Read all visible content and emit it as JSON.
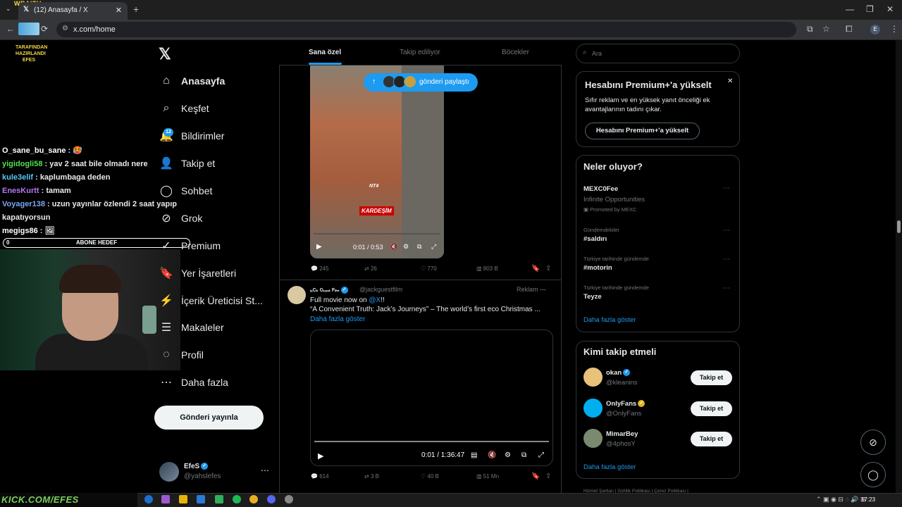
{
  "browser": {
    "overlay_tag": "WRAITH",
    "tab_title": "(12) Anasayfa / X",
    "tab_close": "✕",
    "new_tab": "+",
    "url": "x.com/home",
    "profile_initial": "E",
    "window_controls": [
      "—",
      "❐",
      "✕"
    ]
  },
  "stream_overlay": {
    "logo_text": "TARAFINDAN HAZIRLANDI EFES",
    "chat": [
      {
        "user": "O_sane_bu_sane",
        "user_color": "#ffffff",
        "msg": "🥵"
      },
      {
        "user": "yigidogli58",
        "user_color": "#4ee04e",
        "msg": "yav 2 saat bile olmadı nere"
      },
      {
        "user": "kule3elif",
        "user_color": "#58c8f0",
        "msg": "kaplumbaga deden"
      },
      {
        "user": "EnesKurtt",
        "user_color": "#b478f0",
        "msg": "tamam"
      },
      {
        "user": "Voyager138",
        "user_color": "#7aa6f0",
        "msg": "uzun yayınlar özlendi 2 saat yapıp kapatıyorsun"
      },
      {
        "user": "megigs86",
        "user_color": "#ffffff",
        "msg": "🖼"
      }
    ],
    "goal_count": "0",
    "goal_label": "ABONE HEDEF"
  },
  "sidebar": {
    "logo": "𝕏",
    "items": [
      {
        "label": "Anasayfa",
        "icon": "home-icon",
        "glyph": "⌂",
        "bold": true
      },
      {
        "label": "Keşfet",
        "icon": "search-icon",
        "glyph": "⌕"
      },
      {
        "label": "Bildirimler",
        "icon": "bell-icon",
        "glyph": "🔔"
      },
      {
        "label": "Takip et",
        "icon": "follow-icon",
        "glyph": "👤"
      },
      {
        "label": "Sohbet",
        "icon": "chat-icon",
        "glyph": "◯"
      },
      {
        "label": "Grok",
        "icon": "grok-icon",
        "glyph": "⊘"
      },
      {
        "label": "Premium",
        "icon": "premium-icon",
        "glyph": "✓"
      },
      {
        "label": "Yer İşaretleri",
        "icon": "bookmark-icon",
        "glyph": "🔖"
      },
      {
        "label": "İçerik Üreticisi St...",
        "icon": "creator-icon",
        "glyph": "⚡"
      },
      {
        "label": "Makaleler",
        "icon": "article-icon",
        "glyph": "☰"
      },
      {
        "label": "Profil",
        "icon": "profile-icon",
        "glyph": "◌"
      },
      {
        "label": "Daha fazla",
        "icon": "more-icon",
        "glyph": "⋯"
      }
    ],
    "notif_count": "12",
    "post_button": "Gönderi yayınla",
    "account": {
      "name": "EfeS",
      "handle": "@yahslefes",
      "more": "⋯"
    }
  },
  "feed": {
    "tabs": [
      "Sana özel",
      "Takip ediliyor",
      "Böcekler"
    ],
    "share_pill": "gönderi paylaştı",
    "tweet1": {
      "video_text_logo": "NT4",
      "video_caption": "KARDEŞİM",
      "time": "0:01 / 0:53",
      "replies": "245",
      "retweets": "26",
      "likes": "770",
      "views": "803 B"
    },
    "tweet2": {
      "name": "ᵢₐCₖ Gᵤₑₛₜ Fᵢₗₘ",
      "handle": "@jackguestfilm",
      "ad_label": "Reklam",
      "line1_prefix": "Full movie now on ",
      "line1_link": "@X",
      "line1_suffix": "!!",
      "line2": "“A Convenient Truth: Jack’s Journeys” – The world’s first eco Christmas ...",
      "show_more": "Daha fazla göster",
      "time": "0:01 / 1:36:47",
      "replies": "614",
      "retweets": "3 B",
      "likes": "40 B",
      "views": "51 Mn"
    }
  },
  "right": {
    "search_placeholder": "Ara",
    "premium": {
      "title": "Hesabını Premium+'a yükselt",
      "desc": "Sıfır reklam ve en yüksek yanıt önceliği ek avantajlarının tadını çıkar.",
      "button": "Hesabını Premium+'a yükselt",
      "close": "✕"
    },
    "trends": {
      "title": "Neler oluyor?",
      "items": [
        {
          "ctx": "",
          "main": "MEXC0Fee",
          "sub": "Infinite Opportunities",
          "promo": "Promoted by MEXC"
        },
        {
          "ctx": "Gündemdekiler",
          "main": "#saldırı"
        },
        {
          "ctx": "Türkiye tarihinde gündemde",
          "main": "#motorin"
        },
        {
          "ctx": "Türkiye tarihinde gündemde",
          "main": "Teyze"
        }
      ],
      "show_more": "Daha fazla göster"
    },
    "who_to_follow": {
      "title": "Kimi takip etmeli",
      "items": [
        {
          "name": "okan",
          "handle": "@kleanins",
          "badge": "blue",
          "avatar_color": "#e8c27a"
        },
        {
          "name": "OnlyFans",
          "handle": "@OnlyFans",
          "badge": "gold",
          "avatar_color": "#00aff0"
        },
        {
          "name": "MimarBey",
          "handle": "@4phosY",
          "badge": "",
          "avatar_color": "#7a8a70"
        }
      ],
      "follow_label": "Takip et",
      "show_more": "Daha fazla göster"
    },
    "footer": "Hizmet Şartları  |  Gizlilik Politikası  |  Çerez Politikası  |"
  },
  "taskbar": {
    "banner": "KICK.COM/EFES",
    "clock": "17:23"
  },
  "colors": {
    "accent": "#1d9bf0",
    "background": "#000000",
    "muted": "#71767b"
  }
}
